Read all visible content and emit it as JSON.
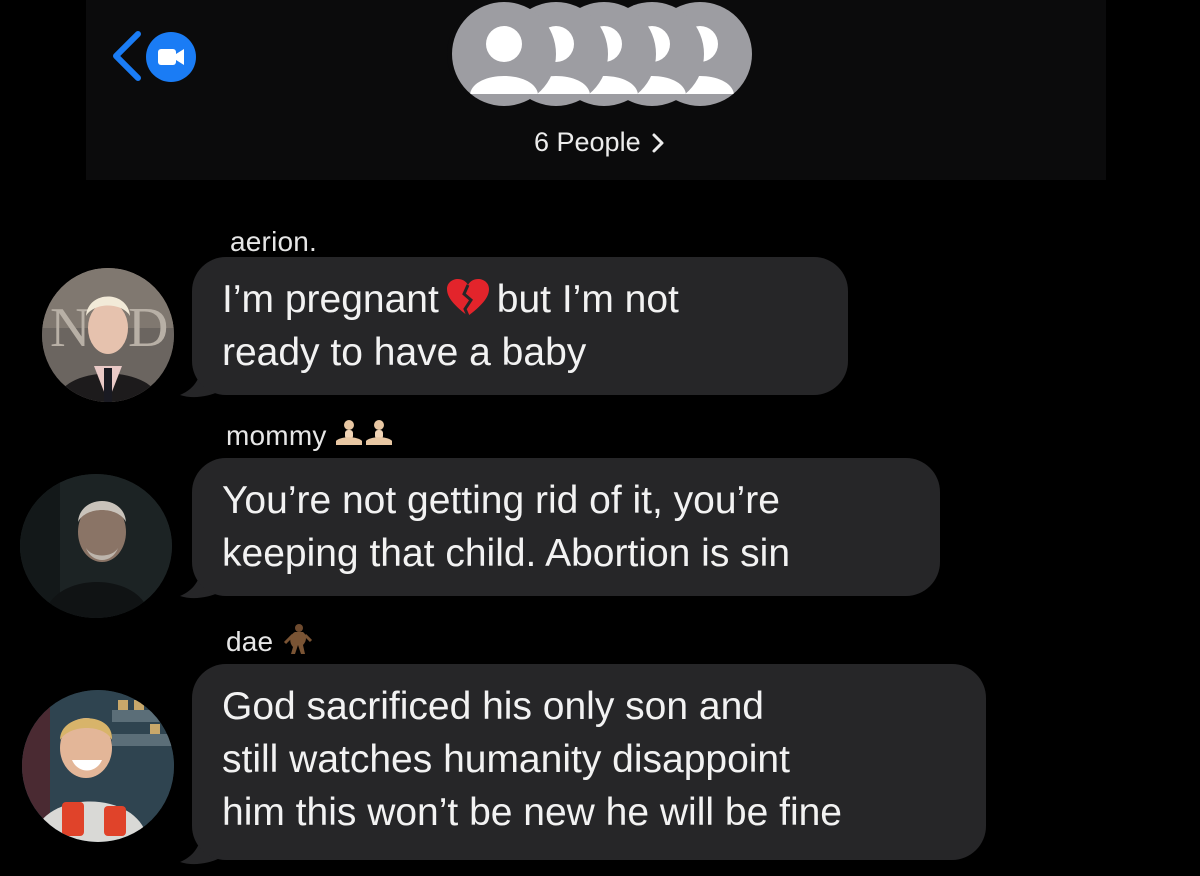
{
  "header": {
    "people_label": "6 People",
    "accent_color": "#1a7cf5",
    "icons": [
      "back-chevron-icon",
      "facetime-video-icon",
      "person-icon",
      "chevron-right-icon"
    ]
  },
  "messages": [
    {
      "sender": "aerion.",
      "text_part1": "I’m pregnant",
      "emoji": "broken-heart-icon",
      "text_part2": "but I’m not\nready to have a baby"
    },
    {
      "sender": "mommy",
      "sender_emoji": "person-in-lotus-position-icon",
      "text": "You’re not getting rid of it, you’re\nkeeping that child. Abortion is sin"
    },
    {
      "sender": "dae",
      "sender_emoji": "bigfoot-icon",
      "text": "God sacrificed his only son and\nstill watches humanity disappoint\nhim this won’t be new he will be fine"
    }
  ],
  "colors": {
    "background": "#000000",
    "bubble": "#262628",
    "avatar_placeholder": "#9d9da2"
  }
}
